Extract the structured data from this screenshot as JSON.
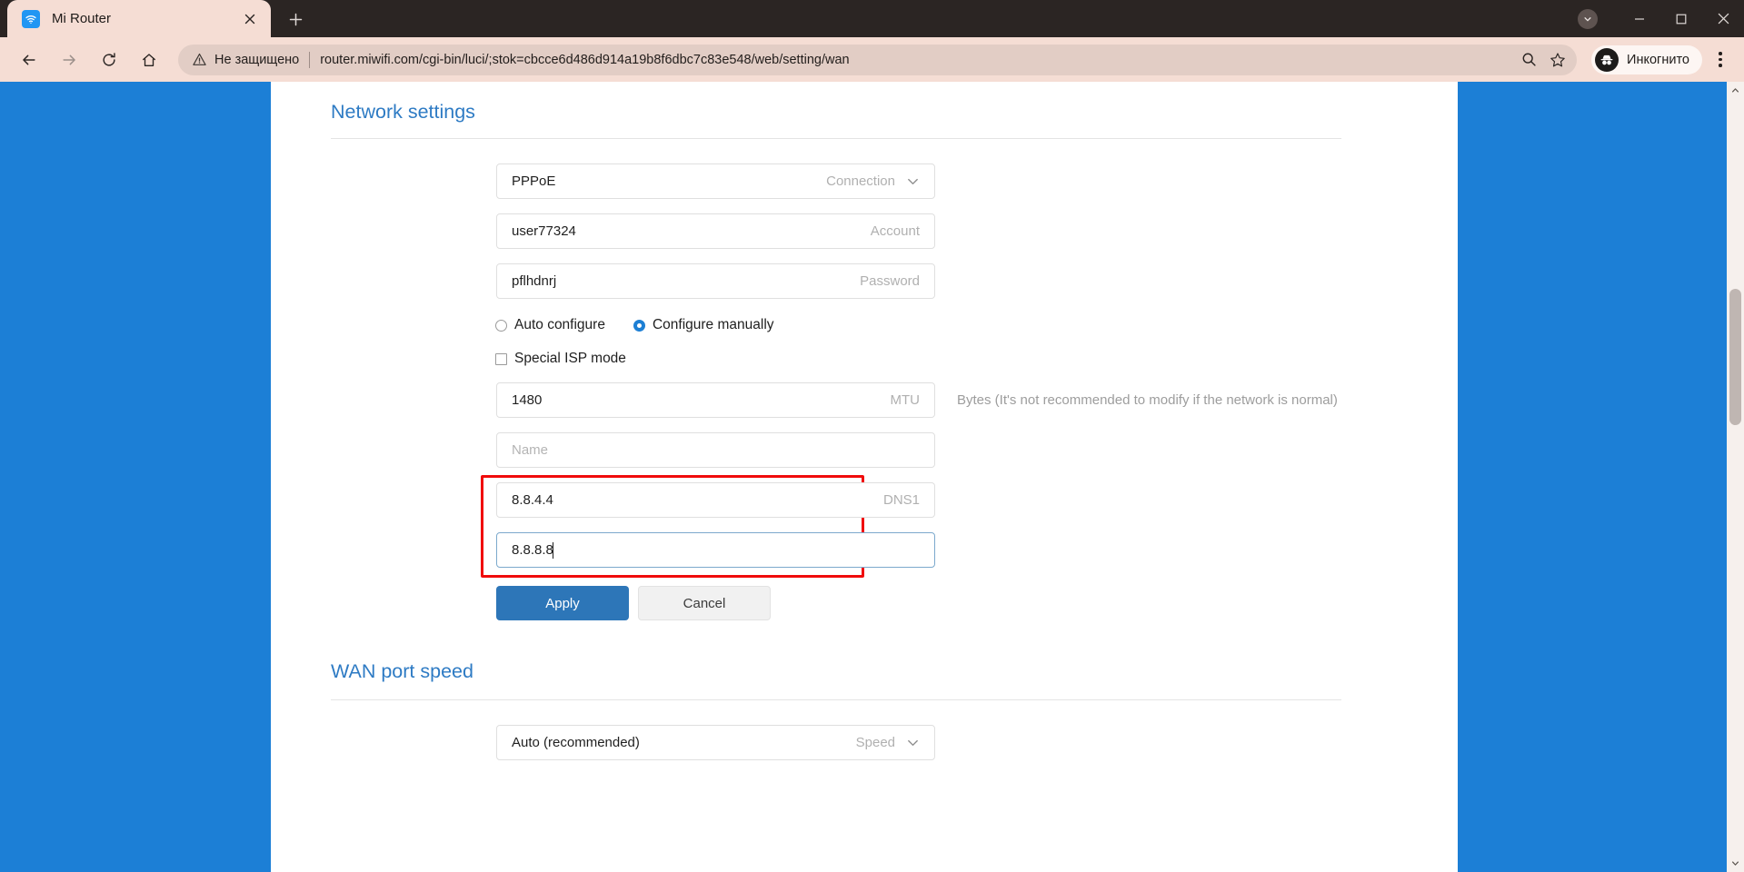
{
  "browser": {
    "tab": {
      "title": "Mi Router",
      "favicon": "wifi-icon",
      "close_label": "×"
    },
    "new_tab_label": "+",
    "window_controls": {
      "minimize": "–",
      "maximize": "☐",
      "close": "✕"
    },
    "nav": {
      "back": "←",
      "forward": "→",
      "reload": "⟳",
      "home": "⌂"
    },
    "omnibox": {
      "security_warning": "Не защищено",
      "url": "router.miwifi.com/cgi-bin/luci/;stok=cbcce6d486d914a19b8f6dbc7c83e548/web/setting/wan",
      "zoom_icon": "search-zoom-icon",
      "bookmark_icon": "star-icon"
    },
    "profile": {
      "label": "Инкогнито",
      "icon": "incognito-icon"
    },
    "menu_icon": "three-dots-icon"
  },
  "page": {
    "network_settings": {
      "title": "Network settings",
      "connection": {
        "value": "PPPoE",
        "label": "Connection",
        "chevron": "chevron-down-icon"
      },
      "account": {
        "value": "user77324",
        "label": "Account"
      },
      "password": {
        "value": "pflhdnrj",
        "label": "Password"
      },
      "config_mode": {
        "auto_label": "Auto configure",
        "manual_label": "Configure manually",
        "selected": "manual"
      },
      "special_isp": {
        "label": "Special ISP mode",
        "checked": false
      },
      "mtu": {
        "value": "1480",
        "label": "MTU",
        "hint": "Bytes (It's not recommended to modify if the network is normal)"
      },
      "name": {
        "placeholder": "Name",
        "value": ""
      },
      "dns1": {
        "value": "8.8.4.4",
        "label": "DNS1"
      },
      "dns2": {
        "value": "8.8.8.8",
        "label": "",
        "focused": true
      },
      "apply_label": "Apply",
      "cancel_label": "Cancel"
    },
    "wan_port_speed": {
      "title": "WAN port speed",
      "speed": {
        "value": "Auto (recommended)",
        "label": "Speed",
        "chevron": "chevron-down-icon"
      }
    }
  },
  "colors": {
    "accent_blue": "#1c7fd6",
    "link_blue": "#2e7bc4",
    "primary_button": "#2d76b8",
    "highlight_red": "#f00b0b",
    "chrome_bg": "#f5ddd4"
  }
}
